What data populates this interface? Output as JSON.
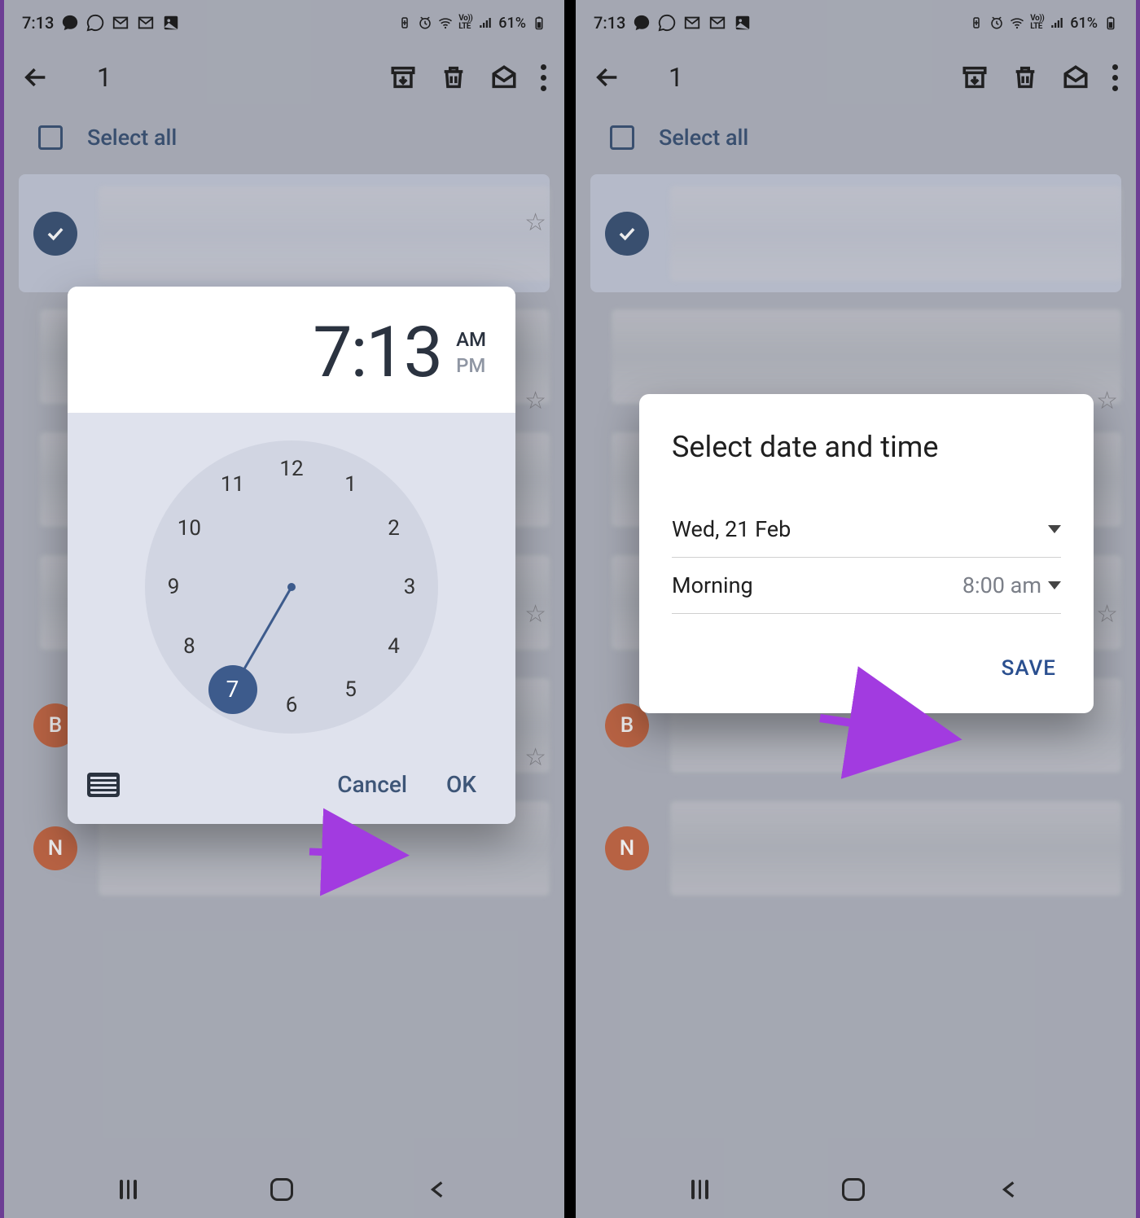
{
  "status": {
    "time": "7:13",
    "battery_pct": "61%"
  },
  "toolbar": {
    "selected_count": "1",
    "select_all_label": "Select all"
  },
  "avatars": {
    "b": "B",
    "n": "N"
  },
  "time_picker": {
    "hour": "7",
    "sep": ":",
    "minute": "13",
    "am": "AM",
    "pm": "PM",
    "numbers": [
      "12",
      "1",
      "2",
      "3",
      "4",
      "5",
      "6",
      "7",
      "8",
      "9",
      "10",
      "11"
    ],
    "selected_number": "7",
    "cancel": "Cancel",
    "ok": "OK"
  },
  "sheet": {
    "title": "Select date and time",
    "date_label": "Wed, 21 Feb",
    "period_label": "Morning",
    "period_time": "8:00 am",
    "save": "SAVE"
  },
  "colors": {
    "accent": "#3d5577",
    "arrow": "#a23be0"
  }
}
